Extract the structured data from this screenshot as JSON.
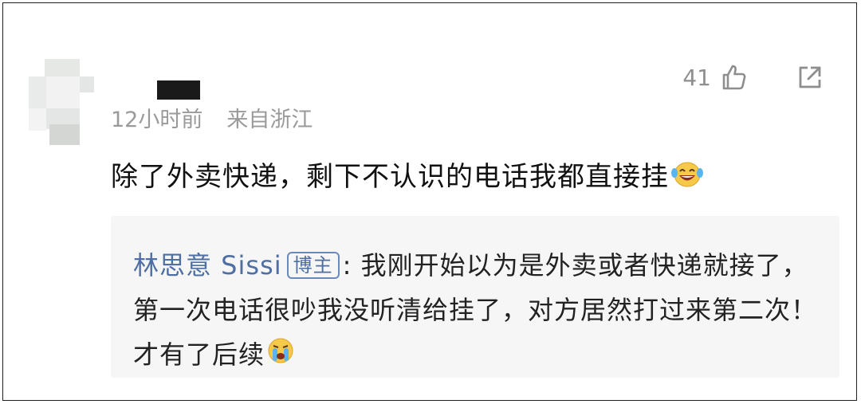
{
  "comment": {
    "time": "12小时前",
    "location": "来自浙江",
    "like_count": "41",
    "text": "除了外卖快递，剩下不认识的电话我都直接挂"
  },
  "icons": {
    "like": "thumbs-up-icon",
    "share": "share-external-icon",
    "emoji_laugh": "laughing-tears-emoji",
    "emoji_cry": "crying-emoji"
  },
  "reply": {
    "author": "林思意 Sissi",
    "badge": "博主",
    "separator": ": ",
    "text": "我刚开始以为是外卖或者快递就接了，第一次电话很吵我没听清给挂了，对方居然打过来第二次！才有了后续"
  },
  "colors": {
    "author_link": "#4f6fa3",
    "meta_gray": "#9a9a9a",
    "reply_bg": "#f6f6f6"
  }
}
